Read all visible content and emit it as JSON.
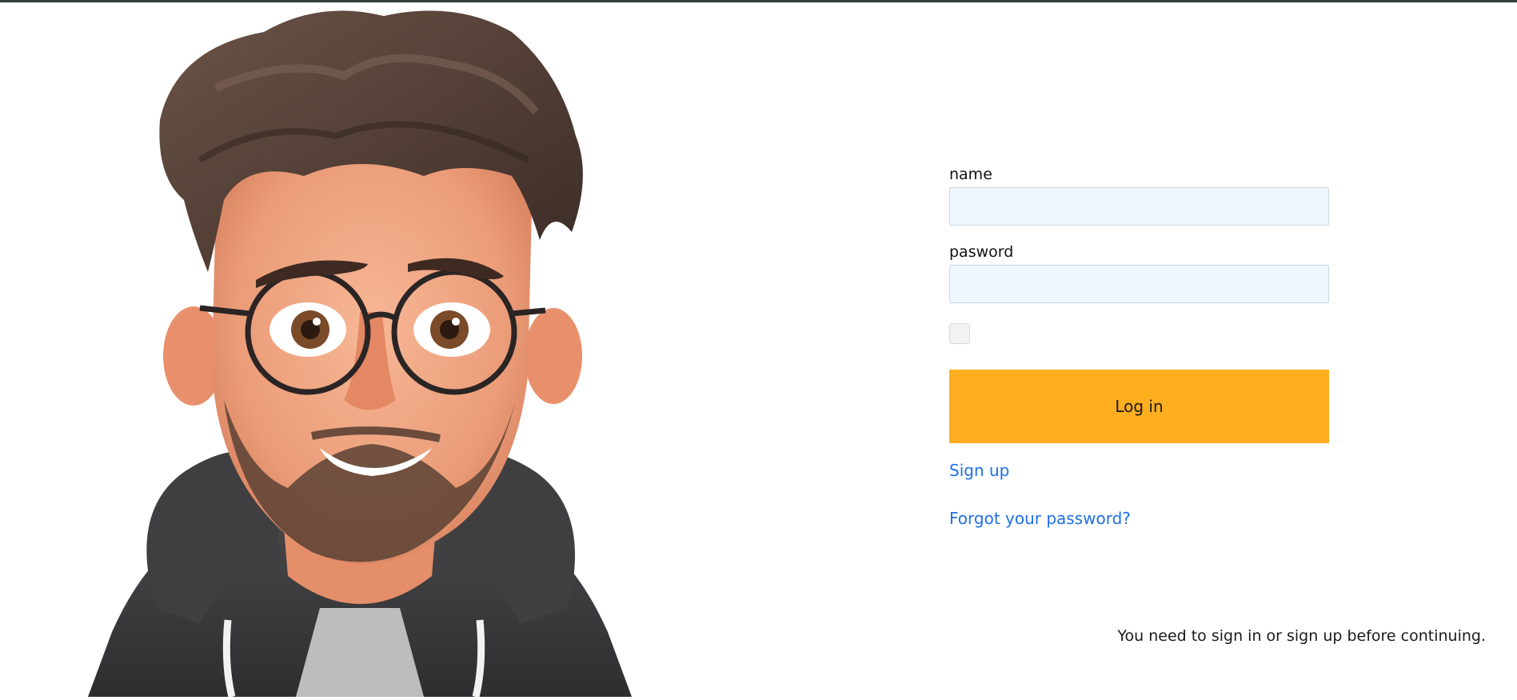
{
  "form": {
    "name_label": "name",
    "name_value": "",
    "password_label": "pasword",
    "password_value": "",
    "login_label": "Log in",
    "signup_link": "Sign up",
    "forgot_link": "Forgot your password?"
  },
  "notice": "You need to sign in or sign up before continuing.",
  "colors": {
    "accent_button": "#ffae1f",
    "link": "#1f6fe6",
    "input_bg": "#eef6fe"
  },
  "illustration": "cartoon-avatar-man-glasses-hoodie"
}
